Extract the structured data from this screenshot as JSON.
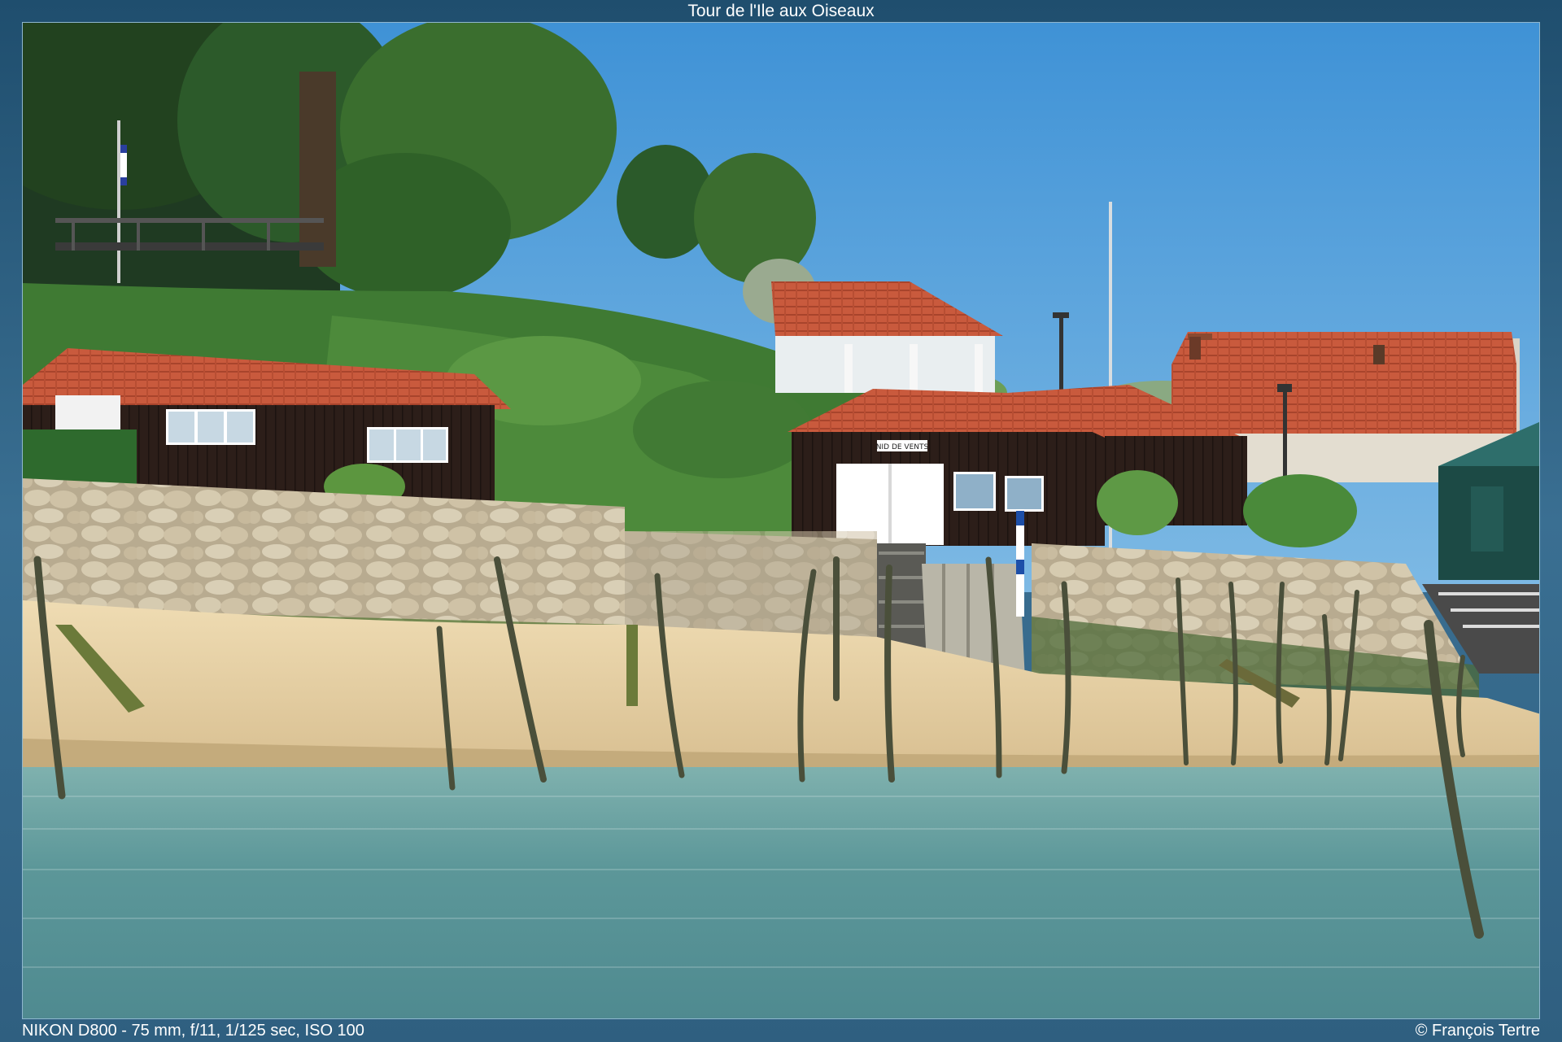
{
  "header": {
    "title": "Tour de l'Ile aux Oiseaux"
  },
  "photo": {
    "subject": "shoreline-with-cabins-and-stakes",
    "boathouse_sign": "NID DE VENTS"
  },
  "footer": {
    "camera_info": "NIKON D800 - 75 mm, f/11, 1/125 sec, ISO 100",
    "copyright": "© François Tertre"
  },
  "colors": {
    "frame": "#2c5a78",
    "sky": "#5aa5dc",
    "water": "#5f9a9f",
    "sand": "#e8d3a8",
    "roof": "#c9543a",
    "cabin": "#2a1c18"
  }
}
